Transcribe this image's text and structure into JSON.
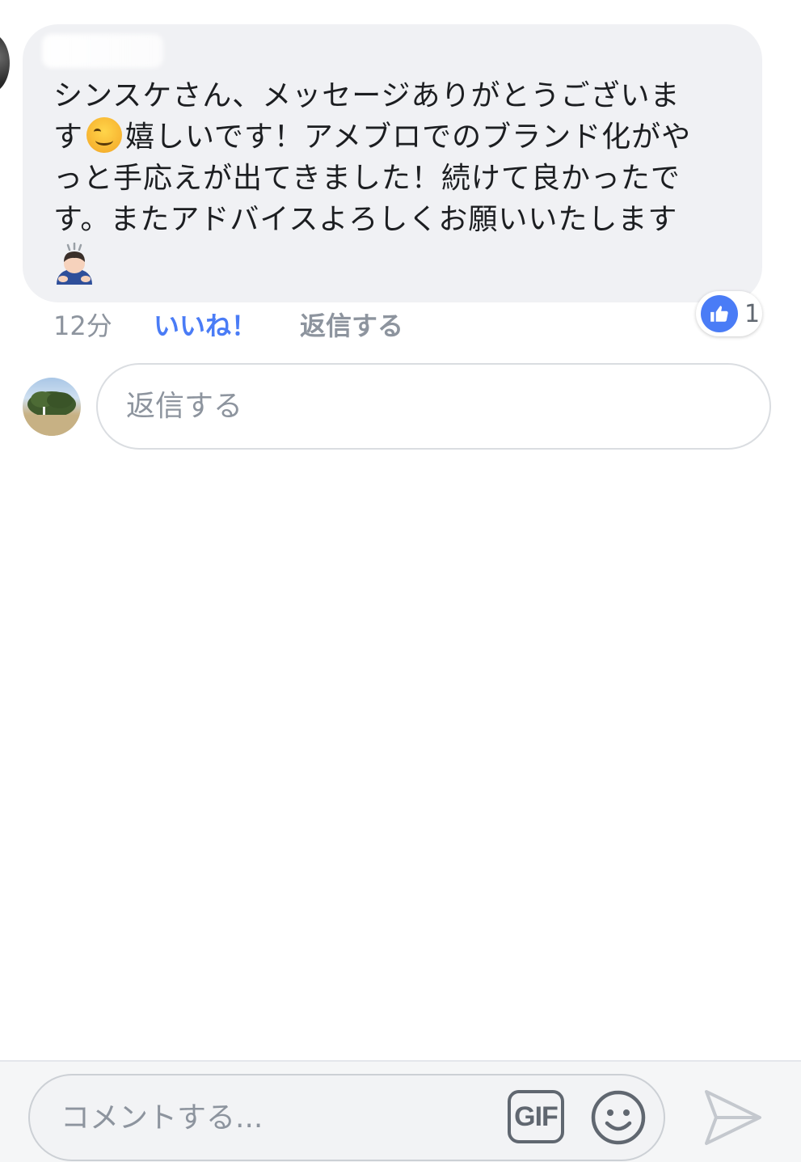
{
  "comment": {
    "author_name": "",
    "text_line1": "シンスケさん、メッセージありがとうございま",
    "text_line2_before_emoji": "す",
    "text_line2_after_emoji": "嬉しいです！アメブロでのブランド化がや",
    "text_line3": "っと手応えが出てきました！続けて良かったで",
    "text_line4": "す。またアドバイスよろしくお願いいたします",
    "emojis": [
      "smiling-face-icon",
      "bowing-person-icon"
    ],
    "time": "12分",
    "like_label": "いいね！",
    "reply_label": "返信する",
    "reaction_count": "1",
    "reaction_type": "like-icon"
  },
  "reply_composer": {
    "placeholder": "返信する"
  },
  "bottom_bar": {
    "comment_placeholder": "コメントする...",
    "gif_label": "GIF",
    "icons": [
      "gif-icon",
      "smiley-icon",
      "send-icon"
    ]
  },
  "colors": {
    "accent_blue": "#4a7cf6",
    "bubble_gray": "#f0f1f4",
    "meta_gray": "#8d949e"
  }
}
